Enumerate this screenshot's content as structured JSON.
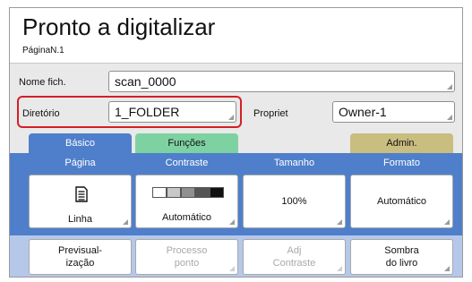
{
  "header": {
    "title": "Pronto a digitalizar",
    "page_info": "PáginaN.1"
  },
  "fields": {
    "file_name_label": "Nome fich.",
    "file_name_value": "scan_0000",
    "directory_label": "Diretório",
    "directory_value": "1_FOLDER",
    "owner_label": "Propriet",
    "owner_value": "Owner-1"
  },
  "tabs": {
    "basic": "Básico",
    "functions": "Funções",
    "admin": "Admin."
  },
  "columns": {
    "page": "Página",
    "contrast": "Contraste",
    "size": "Tamanho",
    "format": "Formato"
  },
  "buttons": {
    "page": "Linha",
    "contrast": "Automático",
    "size": "100%",
    "format": "Automático",
    "preview_line1": "Previsual-",
    "preview_line2": "ização",
    "dot_process_line1": "Processo",
    "dot_process_line2": "ponto",
    "adj_contrast_line1": "Adj",
    "adj_contrast_line2": "Contraste",
    "book_shadow_line1": "Sombra",
    "book_shadow_line2": "do livro"
  },
  "colors": {
    "basic_tab": "#4f7fca",
    "functions_tab": "#7ed2a2",
    "admin_tab": "#c9bd7f",
    "highlight": "#d41f25"
  },
  "icons": {
    "page_button": "document-lines-icon",
    "contrast_button": "contrast-scale-icon"
  }
}
